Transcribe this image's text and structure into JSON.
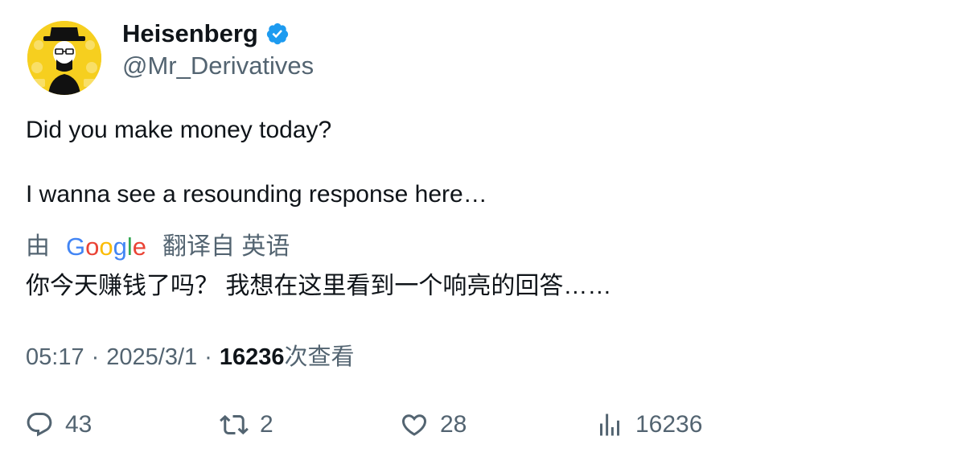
{
  "author": {
    "name": "Heisenberg",
    "handle": "@Mr_Derivatives",
    "avatar": "heisenberg-avatar",
    "verified": true,
    "verified_color": "#1d9bf0"
  },
  "tweet": {
    "lines": [
      "Did you make money today?",
      "I wanna see a resounding response here…"
    ],
    "translation_prefix": "由",
    "translation_provider": "Google",
    "translation_suffix": "翻译自 英语",
    "translated_text": "你今天赚钱了吗？ 我想在这里看到一个响亮的回答……"
  },
  "meta": {
    "time": "05:17",
    "sep1": "·",
    "date": "2025/3/1",
    "sep2": "·",
    "views": "16236",
    "views_label": "次查看"
  },
  "actions": {
    "replies": "43",
    "retweets": "2",
    "likes": "28",
    "views": "16236"
  },
  "colors": {
    "text": "#0f1419",
    "secondary": "#536471",
    "avatar_bg": "#f6cf1f"
  }
}
